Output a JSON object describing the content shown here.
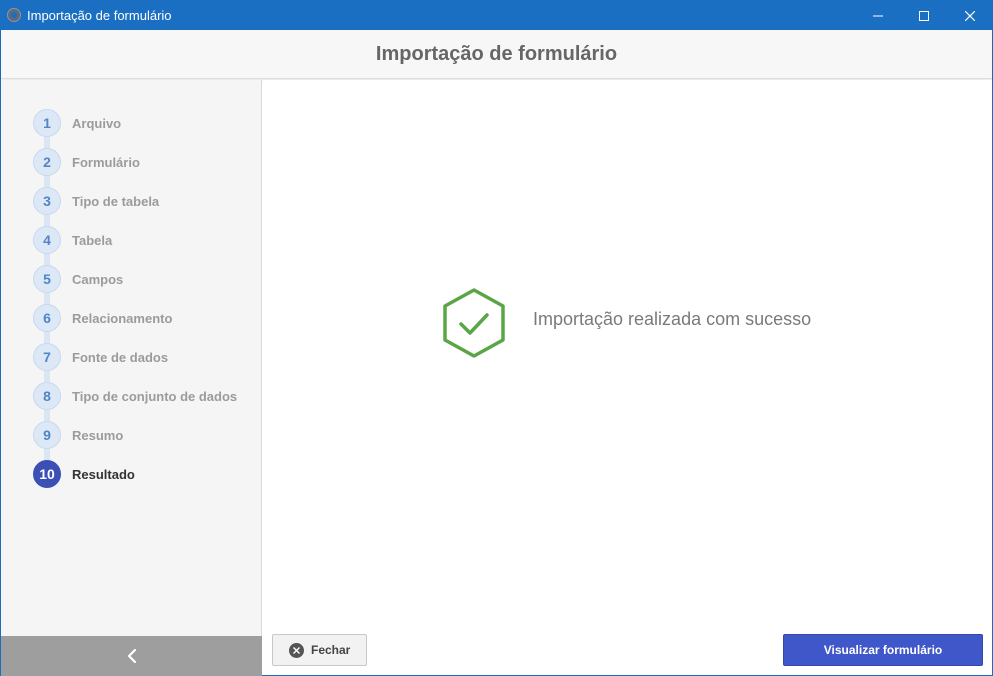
{
  "window": {
    "title": "Importação de formulário"
  },
  "header": {
    "title": "Importação de formulário"
  },
  "steps": [
    {
      "number": "1",
      "label": "Arquivo"
    },
    {
      "number": "2",
      "label": "Formulário"
    },
    {
      "number": "3",
      "label": "Tipo de tabela"
    },
    {
      "number": "4",
      "label": "Tabela"
    },
    {
      "number": "5",
      "label": "Campos"
    },
    {
      "number": "6",
      "label": "Relacionamento"
    },
    {
      "number": "7",
      "label": "Fonte de dados"
    },
    {
      "number": "8",
      "label": "Tipo de conjunto de dados"
    },
    {
      "number": "9",
      "label": "Resumo"
    },
    {
      "number": "10",
      "label": "Resultado"
    }
  ],
  "active_step": 10,
  "main": {
    "message": "Importação realizada com sucesso",
    "status_icon": "check-hexagon-icon"
  },
  "footer": {
    "close_label": "Fechar",
    "view_label": "Visualizar formulário"
  },
  "colors": {
    "titlebar": "#1b6fc2",
    "accent": "#3f57c8",
    "success": "#5aa646"
  }
}
